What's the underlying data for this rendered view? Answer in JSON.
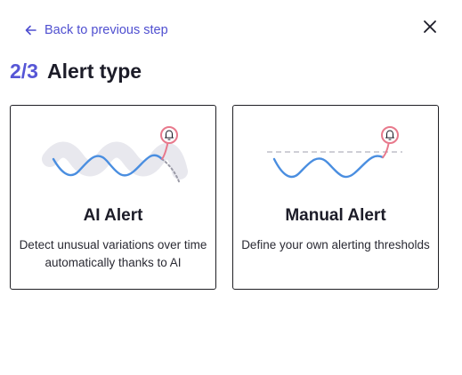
{
  "nav": {
    "back_label": "Back to previous step",
    "back_icon": "arrow-left-icon",
    "close_icon": "close-icon"
  },
  "header": {
    "step": "2/3",
    "title": "Alert type"
  },
  "options": [
    {
      "title": "AI Alert",
      "description": "Detect unusual variations over time automatically thanks to AI",
      "icon": "ai-alert-illustration"
    },
    {
      "title": "Manual Alert",
      "description": "Define your own alerting thresholds",
      "icon": "manual-alert-illustration"
    }
  ],
  "colors": {
    "accent": "#5656d6",
    "line": "#4a8ee0",
    "band": "#e8e8ee",
    "bell": "#e8798c",
    "threshold": "#cfcfd6",
    "border": "#1f1f24"
  }
}
